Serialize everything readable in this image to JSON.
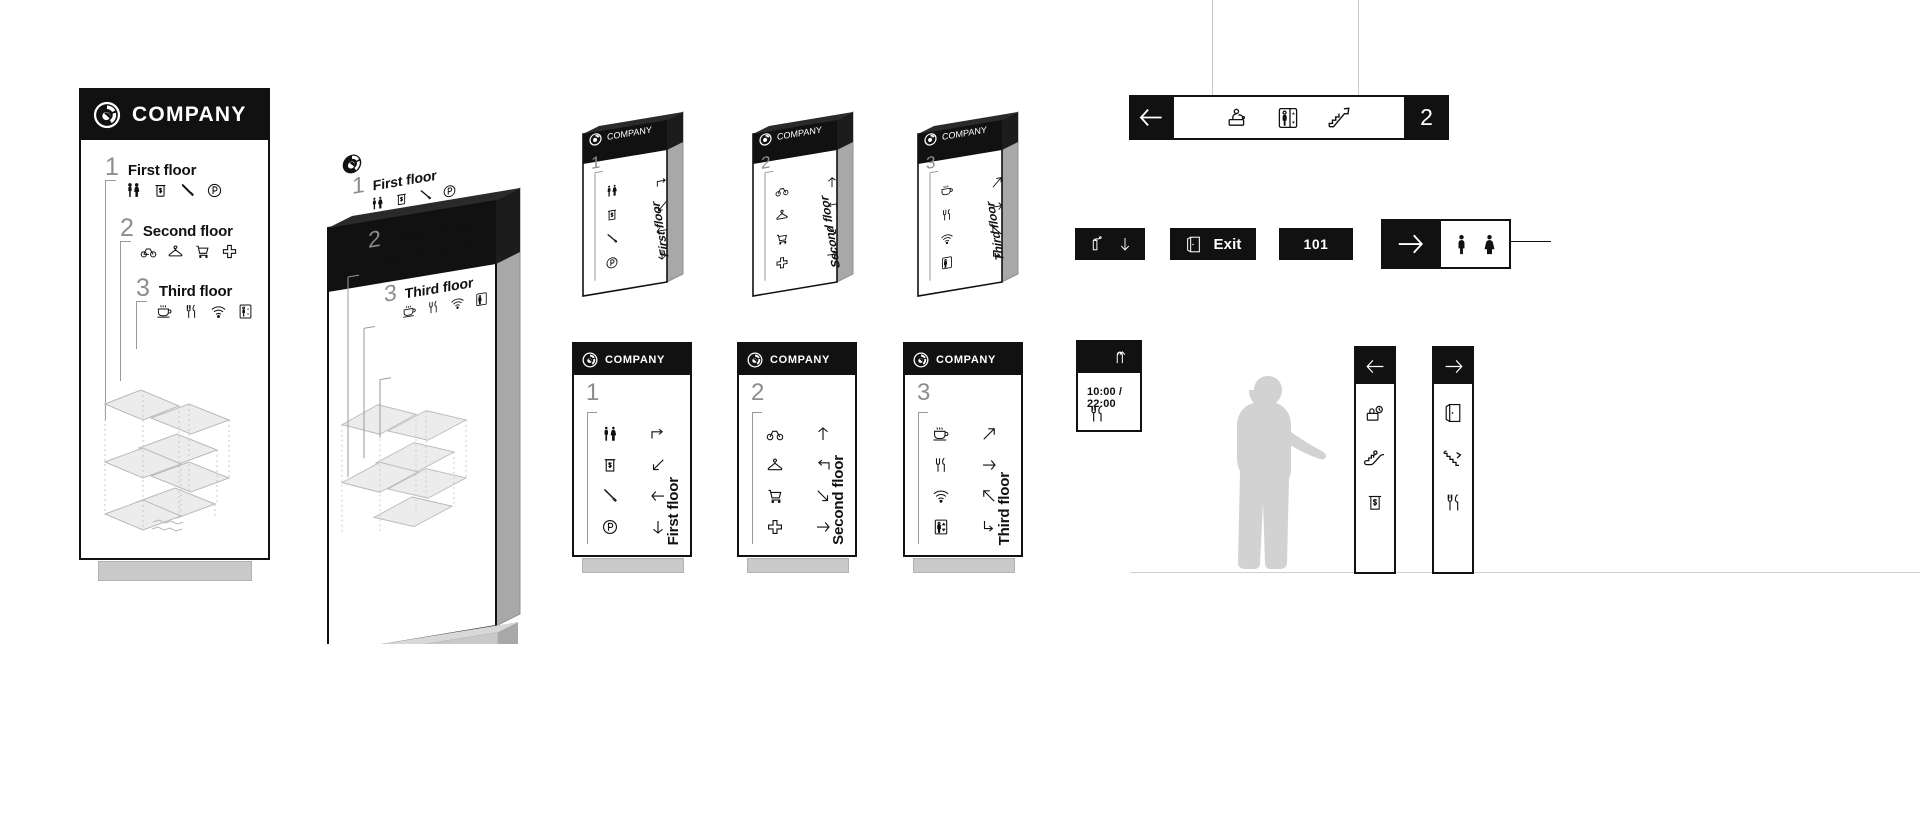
{
  "brand": {
    "name": "COMPANY",
    "logo_icon": "circular-swirl-logo-icon"
  },
  "colors": {
    "ink": "#111111",
    "paper": "#ffffff",
    "muted_gray": "#8d8d8d",
    "base_gray": "#c9c9c9",
    "side_gray": "#a8a8a8",
    "silhouette_gray": "#d2d2d2"
  },
  "directory": {
    "floors": [
      {
        "number": "1",
        "name": "First floor",
        "icons": [
          "restroom-icon",
          "vending-machine-icon",
          "pen-icon",
          "parking-icon"
        ],
        "arrows": [
          "arrow-right-turn",
          "arrow-down-left",
          "arrow-left",
          "arrow-down"
        ]
      },
      {
        "number": "2",
        "name": "Second floor",
        "icons": [
          "bicycle-icon",
          "clothes-hanger-icon",
          "shopping-cart-icon",
          "first-aid-cross-icon"
        ],
        "arrows": [
          "arrow-up",
          "arrow-left",
          "arrow-down-right",
          "arrow-right"
        ]
      },
      {
        "number": "3",
        "name": "Third floor",
        "icons": [
          "coffee-cup-icon",
          "cutlery-icon",
          "wifi-icon",
          "elevator-icon"
        ],
        "arrows": [
          "arrow-up-right",
          "arrow-right",
          "arrow-up-left",
          "arrow-down-turn"
        ]
      }
    ]
  },
  "overhead_sign": {
    "arrow": "arrow-left",
    "icons": [
      "baby-change-icon",
      "elevator-icon",
      "escalator-up-icon"
    ],
    "level": "2"
  },
  "small_signs": {
    "fire": {
      "icon": "fire-extinguisher-icon",
      "arrow": "arrow-down"
    },
    "exit": {
      "icon": "exit-door-icon",
      "label": "Exit"
    },
    "room": {
      "label": "101"
    },
    "restroom": {
      "arrow": "arrow-right",
      "icons": [
        "man-icon",
        "woman-icon"
      ]
    }
  },
  "restaurant_sign": {
    "arrow": "arrow-up-turn",
    "hours": "10:00 / 22:00",
    "icons": [
      "cutlery-icon"
    ]
  },
  "pylons": [
    {
      "arrow": "arrow-left",
      "icons": [
        "baggage-cart-icon",
        "escalator-up-icon",
        "vending-machine-icon"
      ]
    },
    {
      "arrow": "arrow-right",
      "icons": [
        "exit-door-icon",
        "escalator-down-icon",
        "cutlery-icon"
      ]
    }
  ],
  "scale_figure": {
    "label": "person-silhouette"
  }
}
